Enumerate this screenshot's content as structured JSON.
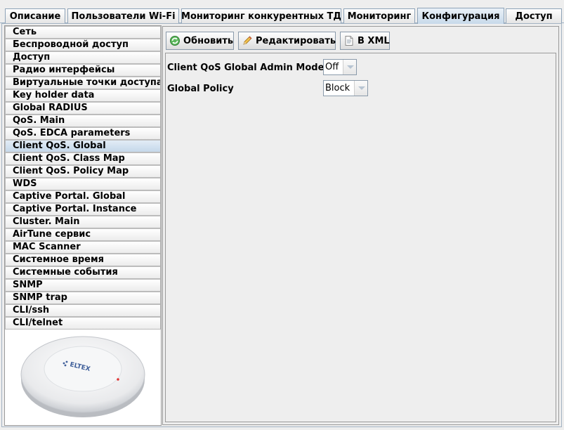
{
  "tabs": [
    {
      "label": "Описание"
    },
    {
      "label": "Пользователи Wi-Fi"
    },
    {
      "label": "Мониторинг конкурентных ТД"
    },
    {
      "label": "Мониторинг"
    },
    {
      "label": "Конфигурация",
      "active": true
    },
    {
      "label": "Доступ"
    }
  ],
  "sidebar": {
    "items": [
      {
        "label": "Сеть"
      },
      {
        "label": "Беспроводной доступ"
      },
      {
        "label": "Доступ"
      },
      {
        "label": "Радио интерфейсы"
      },
      {
        "label": "Виртуальные точки доступа"
      },
      {
        "label": "Key holder data"
      },
      {
        "label": "Global RADIUS"
      },
      {
        "label": "QoS. Main"
      },
      {
        "label": "QoS. EDCA parameters"
      },
      {
        "label": "Client QoS. Global",
        "active": true
      },
      {
        "label": "Client QoS. Class Map"
      },
      {
        "label": "Client QoS. Policy Map"
      },
      {
        "label": "WDS"
      },
      {
        "label": "Captive Portal. Global"
      },
      {
        "label": "Captive Portal. Instance"
      },
      {
        "label": "Cluster. Main"
      },
      {
        "label": "AirTune сервис"
      },
      {
        "label": "MAC Scanner"
      },
      {
        "label": "Системное время"
      },
      {
        "label": "Системные события"
      },
      {
        "label": "SNMP"
      },
      {
        "label": "SNMP trap"
      },
      {
        "label": "CLI/ssh"
      },
      {
        "label": "CLI/telnet"
      }
    ],
    "device_logo": "ELTEX"
  },
  "toolbar": {
    "refresh_label": "Обновить",
    "edit_label": "Редактировать",
    "xml_label": "В XML"
  },
  "form": {
    "admin_mode_label": "Client QoS Global Admin Mode",
    "admin_mode_value": "Off",
    "global_policy_label": "Global Policy",
    "global_policy_value": "Block"
  },
  "icons": {
    "refresh": "refresh-icon",
    "edit": "pencil-icon",
    "xml": "document-icon"
  },
  "colors": {
    "active_tab": "#c7d9ea",
    "active_nav": "#c5d8ea",
    "refresh_green": "#3a9a3a"
  }
}
